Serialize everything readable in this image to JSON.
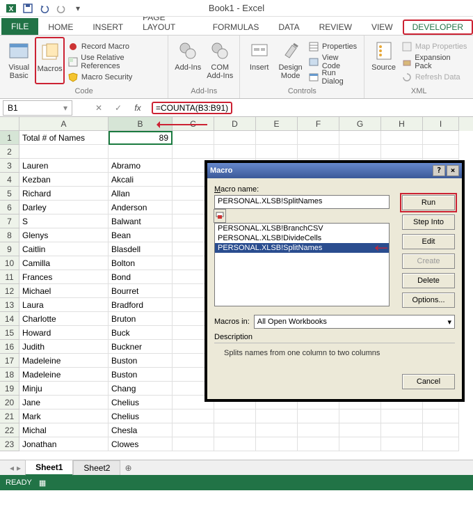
{
  "titlebar": {
    "workbook": "Book1 - Excel"
  },
  "tabs": {
    "file": "FILE",
    "home": "HOME",
    "insert": "INSERT",
    "pagelayout": "PAGE LAYOUT",
    "formulas": "FORMULAS",
    "data": "DATA",
    "review": "REVIEW",
    "view": "VIEW",
    "developer": "DEVELOPER"
  },
  "ribbon": {
    "code": {
      "visualbasic": "Visual Basic",
      "macros": "Macros",
      "record": "Record Macro",
      "relref": "Use Relative References",
      "security": "Macro Security",
      "label": "Code"
    },
    "addins": {
      "addins": "Add-Ins",
      "com": "COM Add-Ins",
      "label": "Add-Ins"
    },
    "controls": {
      "insert": "Insert",
      "design": "Design Mode",
      "properties": "Properties",
      "viewcode": "View Code",
      "rundialog": "Run Dialog",
      "label": "Controls"
    },
    "xml": {
      "source": "Source",
      "mapprops": "Map Properties",
      "expansion": "Expansion Pack",
      "refresh": "Refresh Data",
      "label": "XML"
    }
  },
  "formulabar": {
    "namebox": "B1",
    "formula": "=COUNTA(B3:B91)"
  },
  "columns": [
    "A",
    "B",
    "C",
    "D",
    "E",
    "F",
    "G",
    "H",
    "I"
  ],
  "sheet": {
    "rows": [
      {
        "n": 1,
        "a": "Total # of Names",
        "b": "89",
        "b_num": true,
        "sel": true
      },
      {
        "n": 2,
        "a": "",
        "b": ""
      },
      {
        "n": 3,
        "a": "Lauren",
        "b": "Abramo"
      },
      {
        "n": 4,
        "a": "Kezban",
        "b": "Akcali"
      },
      {
        "n": 5,
        "a": "Richard",
        "b": "Allan"
      },
      {
        "n": 6,
        "a": "Darley",
        "b": "Anderson"
      },
      {
        "n": 7,
        "a": "S",
        "b": "Balwant"
      },
      {
        "n": 8,
        "a": "Glenys",
        "b": "Bean"
      },
      {
        "n": 9,
        "a": "Caitlin",
        "b": "Blasdell"
      },
      {
        "n": 10,
        "a": "Camilla",
        "b": "Bolton"
      },
      {
        "n": 11,
        "a": "Frances",
        "b": "Bond"
      },
      {
        "n": 12,
        "a": "Michael",
        "b": "Bourret"
      },
      {
        "n": 13,
        "a": "Laura",
        "b": "Bradford"
      },
      {
        "n": 14,
        "a": "Charlotte",
        "b": "Bruton"
      },
      {
        "n": 15,
        "a": "Howard",
        "b": "Buck"
      },
      {
        "n": 16,
        "a": "Judith",
        "b": "Buckner"
      },
      {
        "n": 17,
        "a": "Madeleine",
        "b": "Buston"
      },
      {
        "n": 18,
        "a": "Madeleine",
        "b": "Buston"
      },
      {
        "n": 19,
        "a": "Minju",
        "b": "Chang"
      },
      {
        "n": 20,
        "a": "Jane",
        "b": "Chelius"
      },
      {
        "n": 21,
        "a": "Mark",
        "b": "Chelius"
      },
      {
        "n": 22,
        "a": "Michal",
        "b": "Chesla"
      },
      {
        "n": 23,
        "a": "Jonathan",
        "b": "Clowes"
      }
    ]
  },
  "sheettabs": {
    "s1": "Sheet1",
    "s2": "Sheet2"
  },
  "status": {
    "ready": "READY"
  },
  "dialog": {
    "title": "Macro",
    "namelabel": "Macro name:",
    "nameval": "PERSONAL.XLSB!SplitNames",
    "list": [
      "PERSONAL.XLSB!BranchCSV",
      "PERSONAL.XLSB!DivideCells",
      "PERSONAL.XLSB!SplitNames"
    ],
    "macrosin_label": "Macros in:",
    "macrosin_val": "All Open Workbooks",
    "desc_label": "Description",
    "desc_text": "Splits names from one column to two columns",
    "buttons": {
      "run": "Run",
      "stepinto": "Step Into",
      "edit": "Edit",
      "create": "Create",
      "delete": "Delete",
      "options": "Options...",
      "cancel": "Cancel"
    }
  }
}
